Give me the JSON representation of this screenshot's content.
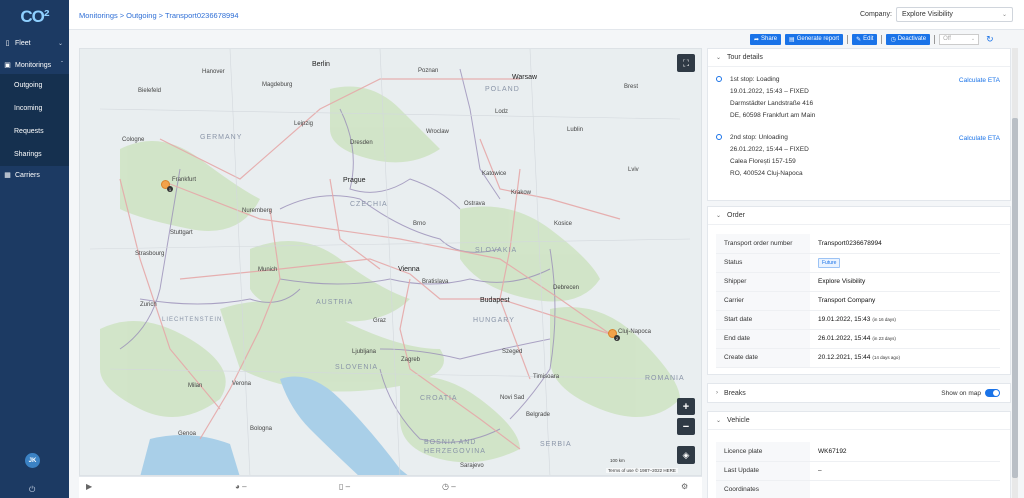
{
  "app": {
    "logo": "CO²"
  },
  "sidebar": {
    "items": [
      {
        "label": "Fleet",
        "icon": "truck-icon"
      },
      {
        "label": "Monitorings",
        "icon": "monitor-icon"
      }
    ],
    "subitems": [
      "Outgoing",
      "Incoming",
      "Requests",
      "Sharings"
    ],
    "carriers": {
      "label": "Carriers",
      "icon": "carrier-icon"
    },
    "avatar_initials": "JK"
  },
  "header": {
    "breadcrumb": [
      "Monitorings",
      "Outgoing",
      "Transport0236678994"
    ],
    "company_label": "Company:",
    "company_value": "Explore Visibility"
  },
  "toolbar": {
    "share": "Share",
    "generate_report": "Generate report",
    "edit": "Edit",
    "deactivate": "Deactivate",
    "select_value": "Off"
  },
  "map": {
    "countries": [
      "POLAND",
      "GERMANY",
      "CZECHIA",
      "SLOVAKIA",
      "AUSTRIA",
      "HUNGARY",
      "ROMANIA",
      "SLOVENIA",
      "CROATIA",
      "SERBIA",
      "BOSNIA AND",
      "HERZEGOVINA",
      "LIECHTENSTEIN"
    ],
    "cities": [
      "Berlin",
      "Warsaw",
      "Hanover",
      "Poznan",
      "Bielefeld",
      "Magdeburg",
      "Leipzig",
      "Dresden",
      "Wroclaw",
      "Lodz",
      "Lublin",
      "Cologne",
      "Frankfurt",
      "Prague",
      "Katowice",
      "Krakow",
      "Lviv",
      "Nuremberg",
      "Brno",
      "Ostrava",
      "Kosice",
      "Stuttgart",
      "Munich",
      "Vienna",
      "Bratislava",
      "Budapest",
      "Strasbourg",
      "Debrecen",
      "Cluj-Napoca",
      "Zurich",
      "Graz",
      "Szeged",
      "Timisoara",
      "Ljubljana",
      "Zagreb",
      "Milan",
      "Verona",
      "Novi Sad",
      "Belgrade",
      "Genoa",
      "Bologna",
      "Sarajevo",
      "Brest"
    ],
    "scale": "100 km",
    "copyright": "Terms of use  © 1987–2022 HERE"
  },
  "map_footer": {
    "item1": "–",
    "item2": "–",
    "item3": "–"
  },
  "tour": {
    "title": "Tour details",
    "stops": [
      {
        "title": "1st stop: Loading",
        "date": "19.01.2022, 15:43 – FIXED",
        "address1": "Darmstädter Landstraße 416",
        "address2": "DE, 60598 Frankfurt am Main",
        "eta": "Calculate ETA"
      },
      {
        "title": "2nd stop: Unloading",
        "date": "26.01.2022, 15:44 – FIXED",
        "address1": "Calea Florești 157-159",
        "address2": "RO, 400524 Cluj-Napoca",
        "eta": "Calculate ETA"
      }
    ]
  },
  "order": {
    "title": "Order",
    "rows": [
      {
        "k": "Transport order number",
        "v": "Transport0236678994"
      },
      {
        "k": "Status",
        "v": "Future"
      },
      {
        "k": "Shipper",
        "v": "Explore Visibility"
      },
      {
        "k": "Carrier",
        "v": "Transport Company"
      },
      {
        "k": "Start date",
        "v": "19.01.2022, 15:43",
        "rel": "(in 16 days)"
      },
      {
        "k": "End date",
        "v": "26.01.2022, 15:44",
        "rel": "(in 23 days)"
      },
      {
        "k": "Create date",
        "v": "20.12.2021, 15:44",
        "rel": "(14 days ago)"
      }
    ]
  },
  "breaks": {
    "title": "Breaks",
    "toggle_label": "Show on map"
  },
  "vehicle": {
    "title": "Vehicle",
    "rows": [
      {
        "k": "Licence plate",
        "v": "WK67192"
      },
      {
        "k": "Last Update",
        "v": "–"
      },
      {
        "k": "Coordinates",
        "v": ""
      }
    ]
  },
  "colors": {
    "sidebar": "#1c3a63",
    "accent": "#1a73e8",
    "marker": "#f2a24a"
  }
}
